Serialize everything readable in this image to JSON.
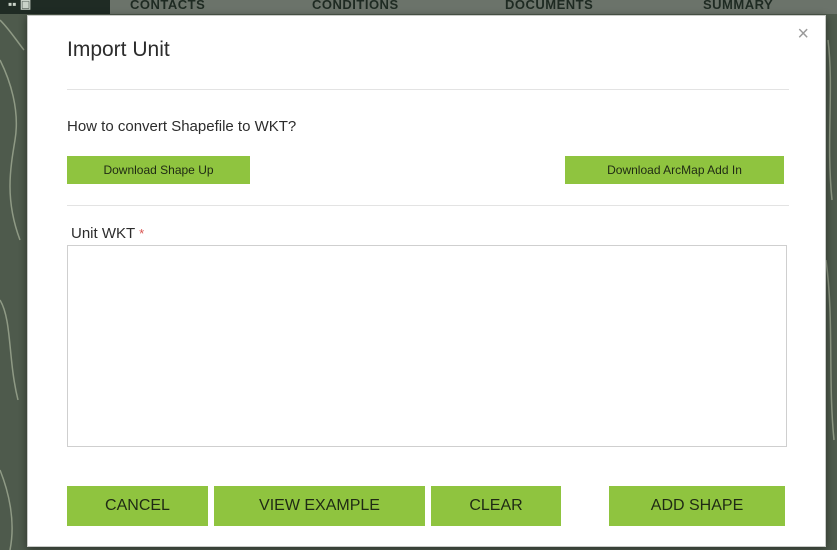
{
  "background_nav": {
    "items": [
      "CONTACTS",
      "CONDITIONS",
      "DOCUMENTS",
      "SUMMARY"
    ]
  },
  "modal": {
    "title": "Import Unit",
    "close_symbol": "×",
    "helper_text": "How to convert Shapefile to WKT?",
    "download_shape_up_label": "Download Shape Up",
    "download_arcmap_label": "Download ArcMap Add In",
    "field": {
      "label": "Unit WKT",
      "required_marker": "*",
      "value": "",
      "placeholder": ""
    },
    "footer": {
      "cancel_label": "CANCEL",
      "view_example_label": "VIEW EXAMPLE",
      "clear_label": "CLEAR",
      "add_shape_label": "ADD SHAPE"
    }
  },
  "colors": {
    "accent_green": "#8fc43f",
    "overlay": "#4e5a4c",
    "required": "#d9534f"
  },
  "icons": {
    "close": "close-icon"
  }
}
